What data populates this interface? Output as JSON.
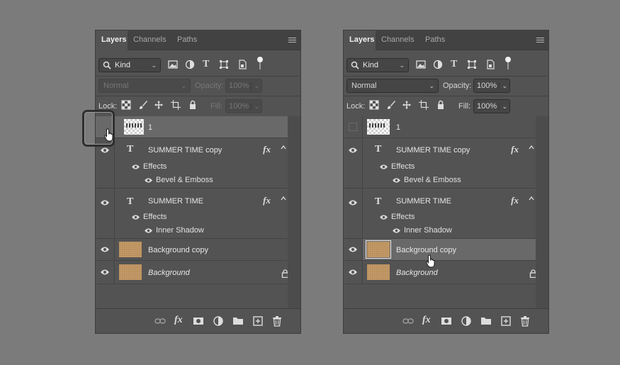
{
  "panels": [
    {
      "tabs": [
        "Layers",
        "Channels",
        "Paths"
      ],
      "filter": {
        "kind_label": "Kind"
      },
      "blend_mode": "Normal",
      "opacity_label": "Opacity:",
      "opacity_value": "100%",
      "lock_label": "Lock:",
      "fill_label": "Fill:",
      "fill_value": "100%",
      "layers": [
        {
          "name": "1",
          "type": "raster"
        },
        {
          "name": "SUMMER TIME copy",
          "type": "text",
          "effects_label": "Effects",
          "effect": "Bevel & Emboss"
        },
        {
          "name": "SUMMER TIME",
          "type": "text",
          "effects_label": "Effects",
          "effect": "Inner Shadow"
        },
        {
          "name": "Background copy",
          "type": "raster"
        },
        {
          "name": "Background",
          "type": "raster",
          "locked": true
        }
      ]
    },
    {
      "tabs": [
        "Layers",
        "Channels",
        "Paths"
      ],
      "filter": {
        "kind_label": "Kind"
      },
      "blend_mode": "Normal",
      "opacity_label": "Opacity:",
      "opacity_value": "100%",
      "lock_label": "Lock:",
      "fill_label": "Fill:",
      "fill_value": "100%",
      "layers": [
        {
          "name": "1",
          "type": "raster"
        },
        {
          "name": "SUMMER TIME copy",
          "type": "text",
          "effects_label": "Effects",
          "effect": "Bevel & Emboss"
        },
        {
          "name": "SUMMER TIME",
          "type": "text",
          "effects_label": "Effects",
          "effect": "Inner Shadow"
        },
        {
          "name": "Background copy",
          "type": "raster",
          "selected": true
        },
        {
          "name": "Background",
          "type": "raster",
          "locked": true
        }
      ]
    }
  ],
  "fx_symbol": "fx",
  "text_layer_symbol": "T",
  "icons": [
    "search-icon",
    "image-filter-icon",
    "adjustment-filter-icon",
    "type-filter-icon",
    "shape-filter-icon",
    "smart-object-filter-icon",
    "filter-toggle-icon",
    "panel-menu-icon",
    "lock-transparent-icon",
    "lock-brush-icon",
    "lock-move-icon",
    "lock-artboard-icon",
    "lock-all-icon",
    "eye-icon",
    "link-icon",
    "fx-icon",
    "mask-icon",
    "adjustment-icon",
    "folder-icon",
    "new-layer-icon",
    "trash-icon",
    "hand-cursor-icon"
  ]
}
